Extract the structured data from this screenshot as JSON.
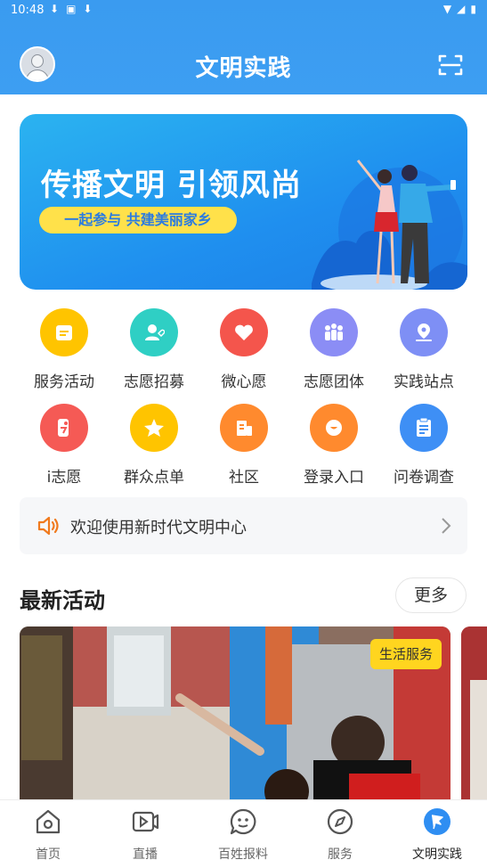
{
  "status_bar": {
    "time": "10:48"
  },
  "header": {
    "title": "文明实践"
  },
  "banner": {
    "title": "传播文明 引领风尚",
    "subtitle": "一起参与 共建美丽家乡"
  },
  "grid": [
    {
      "label": "服务活动",
      "color": "#ffc400",
      "icon": "calendar-icon"
    },
    {
      "label": "志愿招募",
      "color": "#2fcfc4",
      "icon": "user-heart-icon"
    },
    {
      "label": "微心愿",
      "color": "#f4554c",
      "icon": "heart-icon"
    },
    {
      "label": "志愿团体",
      "color": "#8b8df5",
      "icon": "group-icon"
    },
    {
      "label": "实践站点",
      "color": "#7e8ff5",
      "icon": "location-icon"
    },
    {
      "label": "i志愿",
      "color": "#f55a55",
      "icon": "volunteer-icon"
    },
    {
      "label": "群众点单",
      "color": "#ffc400",
      "icon": "star-icon"
    },
    {
      "label": "社区",
      "color": "#ff8a2e",
      "icon": "building-icon"
    },
    {
      "label": "登录入口",
      "color": "#ff8a2e",
      "icon": "login-icon"
    },
    {
      "label": "问卷调查",
      "color": "#3e8ff5",
      "icon": "clipboard-icon"
    }
  ],
  "notice": {
    "text": "欢迎使用新时代文明中心"
  },
  "section": {
    "title": "最新活动",
    "more": "更多"
  },
  "activity": {
    "tag": "生活服务"
  },
  "bottom_nav": [
    {
      "label": "首页",
      "icon": "home-icon",
      "active": false
    },
    {
      "label": "直播",
      "icon": "video-icon",
      "active": false
    },
    {
      "label": "百姓报料",
      "icon": "chat-icon",
      "active": false
    },
    {
      "label": "服务",
      "icon": "compass-icon",
      "active": false
    },
    {
      "label": "文明实践",
      "icon": "flag-icon",
      "active": true
    }
  ]
}
